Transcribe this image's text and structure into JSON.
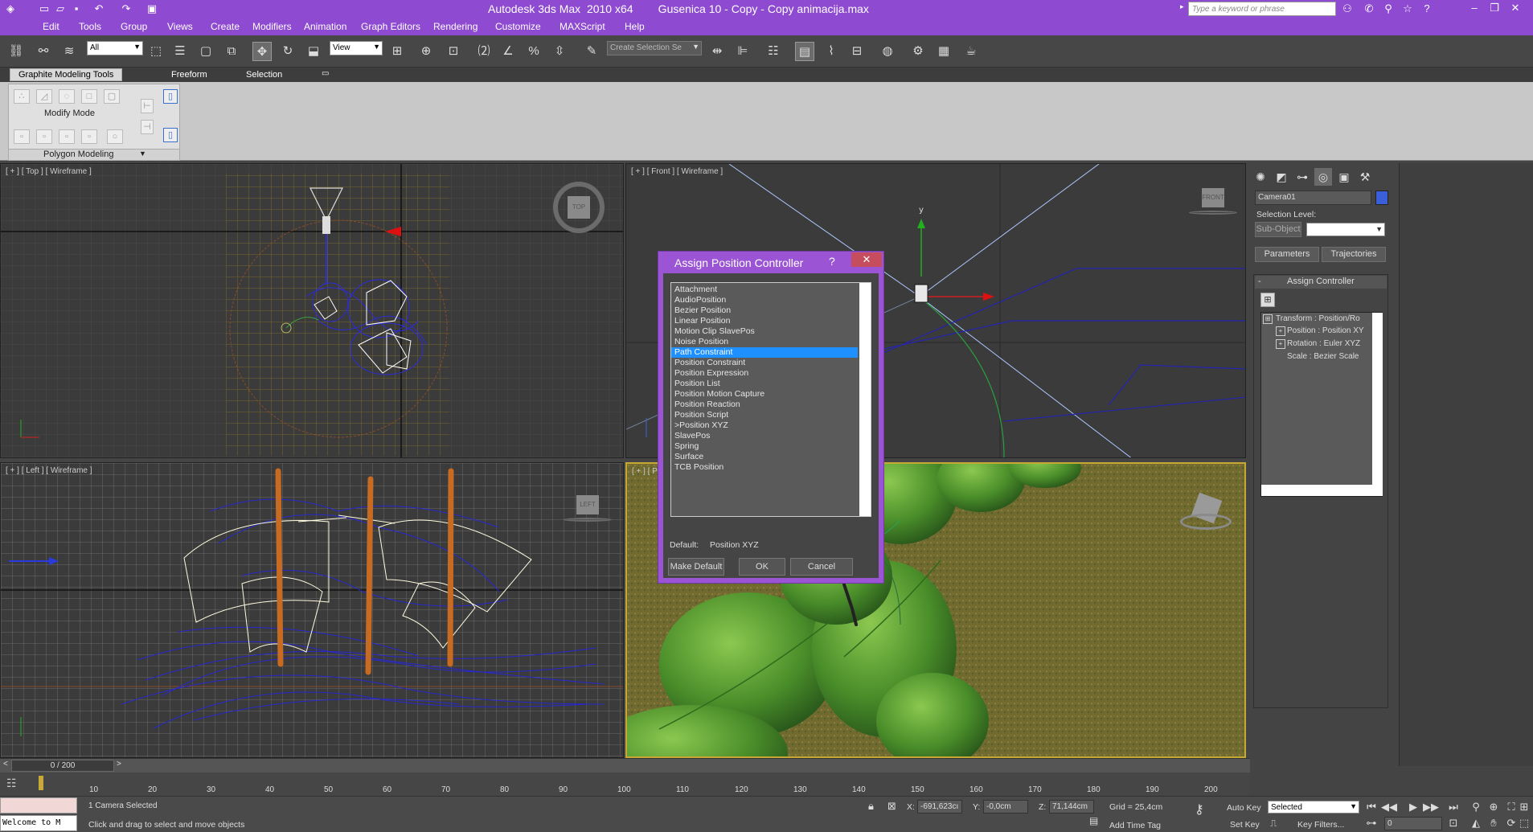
{
  "app": {
    "title": "Autodesk 3ds Max  2010 x64        Gusenica 10 - Copy - Copy animacija.max",
    "search_placeholder": "Type a keyword or phrase"
  },
  "menu": [
    "Edit",
    "Tools",
    "Group",
    "Views",
    "Create",
    "Modifiers",
    "Animation",
    "Graph Editors",
    "Rendering",
    "Customize",
    "MAXScript",
    "Help"
  ],
  "toolbar": {
    "selection_filter": "All",
    "ref_coord": "View",
    "named_selection": "Create Selection Se"
  },
  "ribbon": {
    "tabs": [
      "Graphite Modeling Tools",
      "Freeform",
      "Selection"
    ],
    "modify_mode": "Modify Mode",
    "polygon_modeling": "Polygon Modeling"
  },
  "viewports": {
    "top": "[ + ] [ Top ] [ Wireframe ]",
    "front": "[ + ] [ Front ] [ Wireframe ]",
    "left": "[ + ] [ Left ] [ Wireframe ]",
    "persp": "[ + ] [ P",
    "cube_top": "TOP",
    "cube_front": "FRONT",
    "cube_left": "LEFT",
    "axis_y": "y"
  },
  "dialog": {
    "title": "Assign Position Controller",
    "help": "?",
    "close": "✕",
    "items": [
      "Attachment",
      "AudioPosition",
      "Bezier Position",
      "Linear Position",
      "Motion Clip SlavePos",
      "Noise Position",
      "Path Constraint",
      "Position Constraint",
      "Position Expression",
      "Position List",
      "Position Motion Capture",
      "Position Reaction",
      "Position Script",
      ">Position XYZ",
      "SlavePos",
      "Spring",
      "Surface",
      "TCB Position"
    ],
    "selected_index": 6,
    "default_label": "Default:",
    "default_value": "Position XYZ",
    "make_default": "Make Default",
    "ok": "OK",
    "cancel": "Cancel"
  },
  "command_panel": {
    "object_name": "Camera01",
    "object_color": "#3a5fd9",
    "selection_level_label": "Selection Level:",
    "sub_object": "Sub-Object",
    "tab_parameters": "Parameters",
    "tab_trajectories": "Trajectories",
    "rollout_title": "Assign Controller",
    "rollout_sign": "-",
    "tree": [
      "Transform : Position/Ro",
      "Position : Position XY",
      "Rotation : Euler XYZ",
      "Scale : Bezier Scale"
    ]
  },
  "time": {
    "slider_label": "0 / 200",
    "slider_prev": "<",
    "slider_next": ">",
    "ticks": [
      "10",
      "20",
      "30",
      "40",
      "50",
      "60",
      "70",
      "80",
      "90",
      "100",
      "110",
      "120",
      "130",
      "140",
      "150",
      "160",
      "170",
      "180",
      "190",
      "200"
    ]
  },
  "status": {
    "maxscript": "Welcome to M",
    "selected": "1 Camera Selected",
    "prompt": "Click and drag to select and move objects",
    "x_label": "X:",
    "x_value": "-691,623cı",
    "y_label": "Y:",
    "y_value": "-0,0cm",
    "z_label": "Z:",
    "z_value": "71,144cm",
    "grid": "Grid = 25,4cm",
    "add_time_tag": "Add Time Tag",
    "auto_key": "Auto Key",
    "set_key": "Set Key",
    "key_mode": "Selected",
    "key_filters": "Key Filters...",
    "current_frame": "0"
  }
}
